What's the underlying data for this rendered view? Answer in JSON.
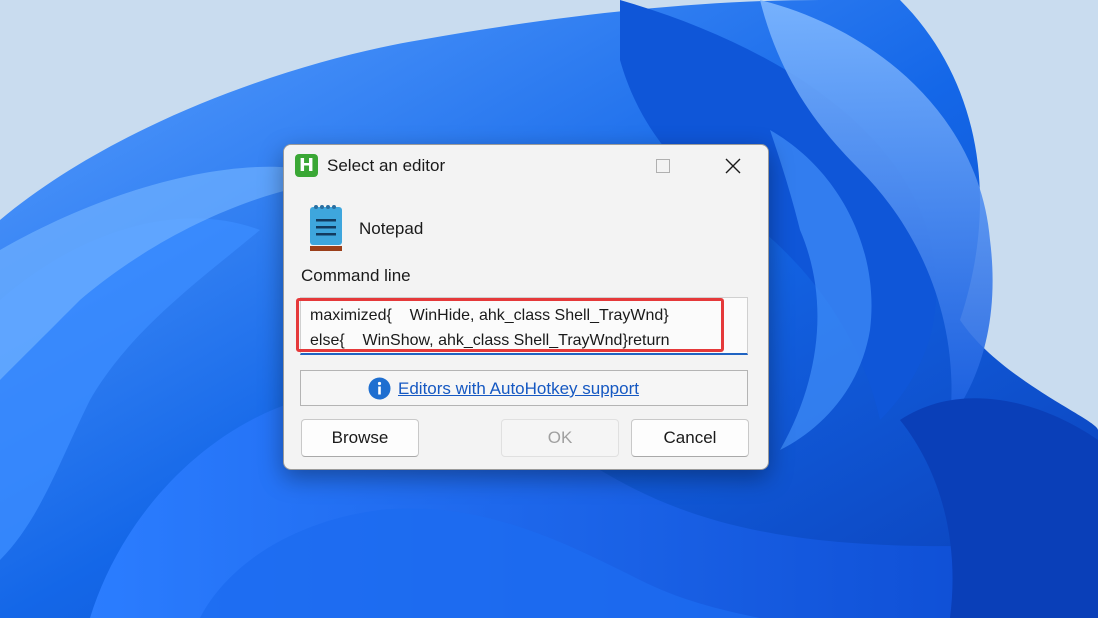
{
  "window": {
    "title": "Select an editor",
    "app_icon_letter": "H",
    "app_icon_color": "#3aa735"
  },
  "editor": {
    "name": "Notepad",
    "icon": "notepad-icon"
  },
  "command": {
    "label": "Command line",
    "line1": "maximized{    WinHide, ahk_class Shell_TrayWnd}",
    "line2": "else{    WinShow, ahk_class Shell_TrayWnd}return"
  },
  "support": {
    "icon": "info-icon",
    "link_text": "Editors with AutoHotkey support"
  },
  "buttons": {
    "browse": "Browse",
    "ok": "OK",
    "cancel": "Cancel"
  },
  "colors": {
    "highlight": "#e5393a",
    "link": "#1558c2",
    "accent": "#1f63c2"
  }
}
